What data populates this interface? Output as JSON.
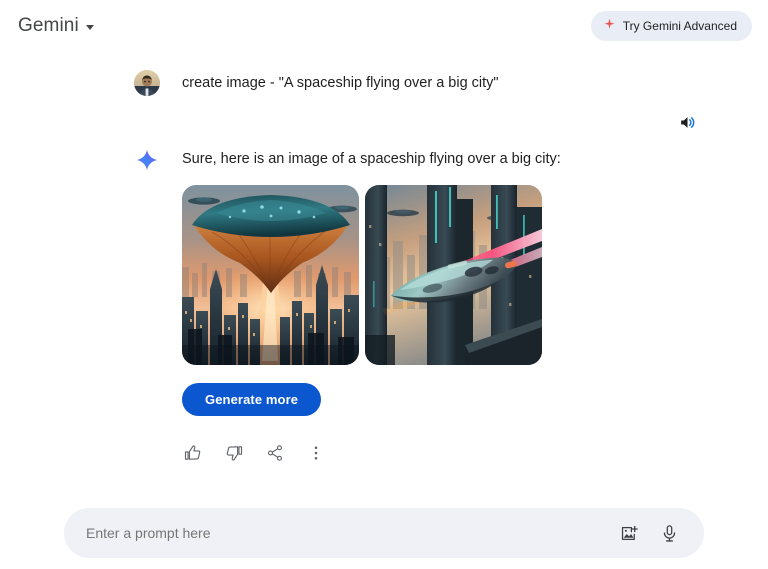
{
  "header": {
    "brand_title": "Gemini",
    "brand_caret_icon": "chevron-down-icon",
    "advanced_button_label": "Try Gemini Advanced",
    "advanced_button_icon": "sparkle-icon",
    "advanced_accent_color": "#d93025",
    "advanced_bg_color": "#e9eef6"
  },
  "conversation": {
    "user": {
      "avatar_icon": "user-avatar-photo",
      "message": "create image - \"A spaceship flying over a big city\""
    },
    "speaker": {
      "icon": "speaker-icon",
      "label": "Listen"
    },
    "model": {
      "avatar_icon": "gemini-sparkle-icon",
      "message": "Sure, here is an image of a spaceship flying over a big city:",
      "images": [
        {
          "name": "generated-image-1",
          "alt": "Large saucer-shaped mothership hovering over a city skyline at sunset with a glowing beam",
          "palette": {
            "sky_top": "#8fa3ae",
            "sky_glow": "#e8a072",
            "sky_low": "#f0c39a",
            "ship_top": "#2e6a72",
            "ship_under": "#c87840",
            "city": "#2b3840",
            "beam": "#ffd9a0"
          }
        },
        {
          "name": "generated-image-2",
          "alt": "Sleek teal and grey spaceship flying between dark skyscrapers with magenta light trails",
          "palette": {
            "sky": "#e8c49a",
            "sky_high": "#7d93a4",
            "building_dark": "#232f37",
            "building_mid": "#3c4e58",
            "ship_body": "#7fa9a8",
            "trail_pink": "#f2547d",
            "trail_orange": "#f08a3c"
          }
        }
      ],
      "generate_more_label": "Generate more",
      "generate_more_color": "#0b57d0",
      "feedback_actions": [
        {
          "name": "thumb-up-icon",
          "label": "Good response"
        },
        {
          "name": "thumb-down-icon",
          "label": "Bad response"
        },
        {
          "name": "share-icon",
          "label": "Share & export"
        },
        {
          "name": "more-vert-icon",
          "label": "More"
        }
      ]
    }
  },
  "prompt": {
    "placeholder": "Enter a prompt here",
    "value": "",
    "add_image_icon": "add-image-icon",
    "mic_icon": "microphone-icon",
    "background": "#eff1f6"
  }
}
